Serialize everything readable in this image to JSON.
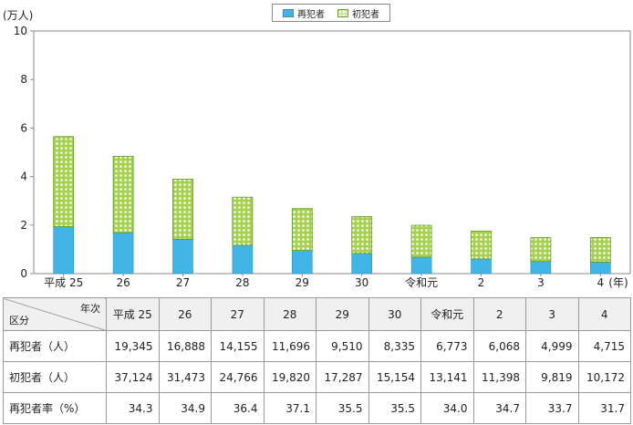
{
  "chart_data": {
    "type": "bar",
    "stacked": true,
    "categories": [
      "平成 25",
      "26",
      "27",
      "28",
      "29",
      "30",
      "令和元",
      "2",
      "3",
      "4"
    ],
    "x_unit": "(年)",
    "y_unit": "(万人)",
    "ylim": [
      0,
      10
    ],
    "yticks": [
      0,
      2,
      4,
      6,
      8,
      10
    ],
    "grid": false,
    "legend_position": "top-center",
    "series": [
      {
        "name": "再犯者",
        "color": "#41b6e6",
        "values": [
          1.9345,
          1.6888,
          1.4155,
          1.1696,
          0.951,
          0.8335,
          0.6773,
          0.6068,
          0.4999,
          0.4715
        ]
      },
      {
        "name": "初犯者",
        "color": "#9ccc46",
        "values": [
          3.7124,
          3.1473,
          2.4766,
          1.982,
          1.7287,
          1.5154,
          1.3141,
          1.1398,
          0.9819,
          1.0172
        ]
      }
    ]
  },
  "table": {
    "corner_top": "年次",
    "corner_bottom": "区分",
    "columns": [
      "平成 25",
      "26",
      "27",
      "28",
      "29",
      "30",
      "令和元",
      "2",
      "3",
      "4"
    ],
    "rows": [
      {
        "label": "再犯者（人）",
        "values": [
          "19,345",
          "16,888",
          "14,155",
          "11,696",
          "9,510",
          "8,335",
          "6,773",
          "6,068",
          "4,999",
          "4,715"
        ]
      },
      {
        "label": "初犯者（人）",
        "values": [
          "37,124",
          "31,473",
          "24,766",
          "19,820",
          "17,287",
          "15,154",
          "13,141",
          "11,398",
          "9,819",
          "10,172"
        ]
      },
      {
        "label": "再犯者率（%）",
        "values": [
          "34.3",
          "34.9",
          "36.4",
          "37.1",
          "35.5",
          "35.5",
          "34.0",
          "34.7",
          "33.7",
          "31.7"
        ]
      }
    ]
  }
}
